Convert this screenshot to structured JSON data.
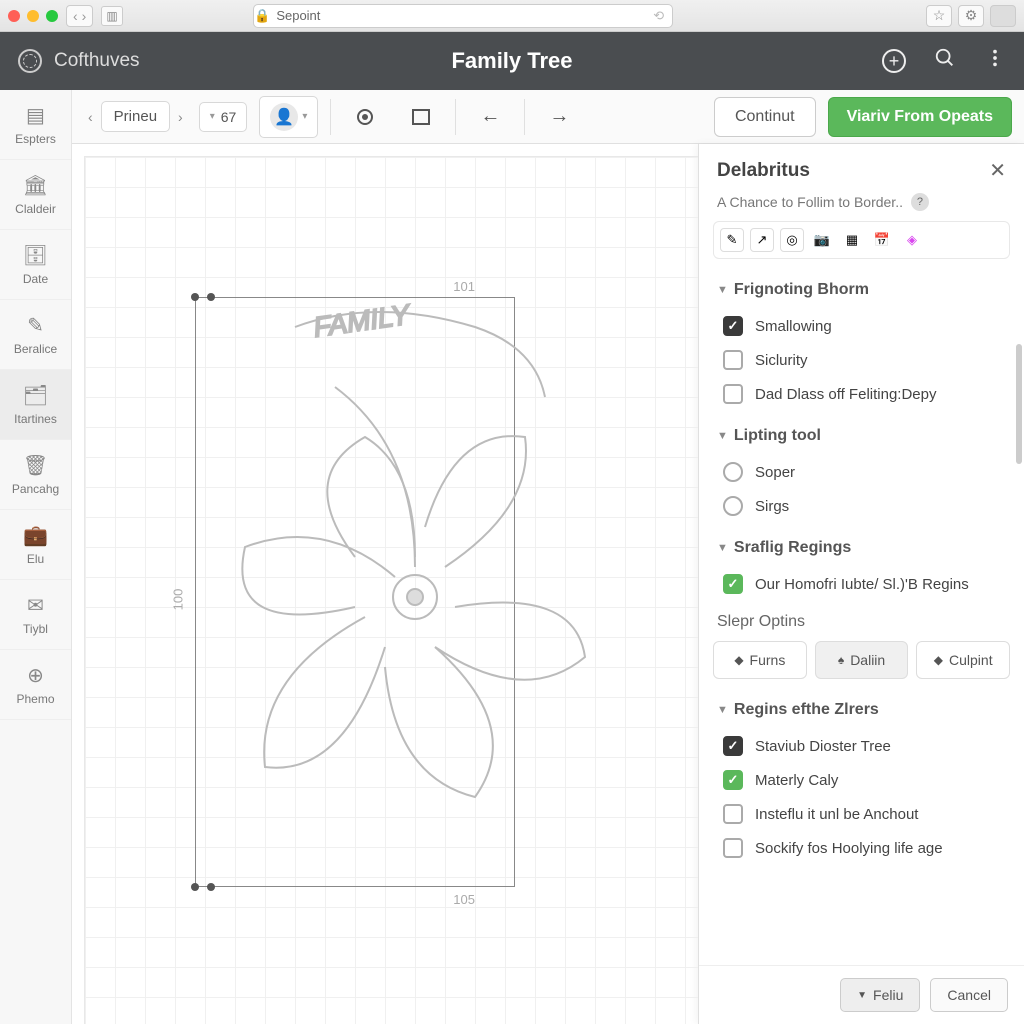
{
  "browser": {
    "url_label": "Sepoint"
  },
  "header": {
    "brand": "Cofthuves",
    "title": "Family Tree"
  },
  "toolbar": {
    "breadcrumb": "Prineu",
    "number": "67",
    "continue": "Continut",
    "primary": "Viariv From Opeats"
  },
  "rail": {
    "items": [
      {
        "label": "Espters"
      },
      {
        "label": "Claldeir"
      },
      {
        "label": "Date"
      },
      {
        "label": "Beralice"
      },
      {
        "label": "Itartines"
      },
      {
        "label": "Pancahg"
      },
      {
        "label": "Elu"
      },
      {
        "label": "Tiybl"
      },
      {
        "label": "Phemo"
      }
    ]
  },
  "canvas": {
    "dim_top": "101",
    "dim_left": "100",
    "dim_bottom": "105"
  },
  "panel": {
    "title": "Delabritus",
    "subtitle": "A Chance to Follim to Border..",
    "sections": {
      "s1": {
        "title": "Frignoting Bhorm",
        "opts": [
          "Smallowing",
          "Siclurity",
          "Dad Dlass off Feliting:Depy"
        ]
      },
      "s2": {
        "title": "Lipting tool",
        "opts": [
          "Soper",
          "Sirgs"
        ]
      },
      "s3": {
        "title": "Sraflig Regings",
        "opts": [
          "Our Homofri Iubte/ Sl.)'B Regins"
        ]
      },
      "slepr": {
        "title": "Slepr Optins",
        "buttons": [
          "Furns",
          "Daliin",
          "Culpint"
        ]
      },
      "s4": {
        "title": "Regins efthe Zlrers",
        "opts": [
          "Staviub Dioster Tree",
          "Materly Caly",
          "Insteflu it unl be Anchout",
          "Sockify fos Hoolying life age"
        ]
      }
    },
    "footer": {
      "apply": "Feliu",
      "cancel": "Cancel"
    }
  }
}
